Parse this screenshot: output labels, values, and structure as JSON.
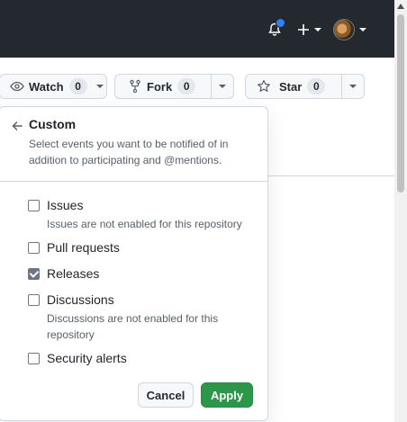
{
  "header": {
    "notification_icon": "bell-icon",
    "notification_dot_color": "#2f81f7",
    "create_icon": "plus-icon",
    "avatar_icon": "user-avatar"
  },
  "repo_actions": {
    "watch": {
      "label": "Watch",
      "count": "0"
    },
    "fork": {
      "label": "Fork",
      "count": "0"
    },
    "star": {
      "label": "Star",
      "count": "0"
    }
  },
  "popover": {
    "title": "Custom",
    "description": "Select events you want to be notified of in addition to participating and @mentions.",
    "options": [
      {
        "label": "Issues",
        "checked": false,
        "note": "Issues are not enabled for this repository"
      },
      {
        "label": "Pull requests",
        "checked": false,
        "note": ""
      },
      {
        "label": "Releases",
        "checked": true,
        "note": ""
      },
      {
        "label": "Discussions",
        "checked": false,
        "note": "Discussions are not enabled for this repository"
      },
      {
        "label": "Security alerts",
        "checked": false,
        "note": ""
      }
    ],
    "cancel_label": "Cancel",
    "apply_label": "Apply"
  },
  "colors": {
    "header_bg": "#24292f",
    "apply_bg": "#2c974b",
    "border": "#d0d7de"
  }
}
